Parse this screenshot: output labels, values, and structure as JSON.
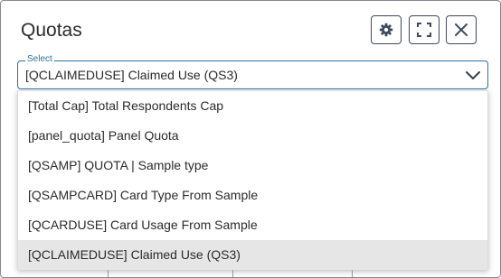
{
  "header": {
    "title": "Quotas",
    "buttons": [
      {
        "name": "settings",
        "icon": "gear-icon"
      },
      {
        "name": "expand",
        "icon": "expand-icon"
      },
      {
        "name": "close",
        "icon": "close-icon"
      }
    ]
  },
  "select": {
    "label": "Select",
    "value": "[QCLAIMEDUSE] Claimed Use (QS3)",
    "icon": "chevron-down-icon"
  },
  "dropdown": {
    "options": [
      {
        "label": "[Total Cap] Total Respondents Cap"
      },
      {
        "label": "[panel_quota] Panel Quota"
      },
      {
        "label": "[QSAMP] QUOTA | Sample type"
      },
      {
        "label": "[QSAMPCARD] Card Type From Sample"
      },
      {
        "label": "[QCARDUSE] Card Usage From Sample"
      },
      {
        "label": "[QCLAIMEDUSE] Claimed Use (QS3)"
      }
    ],
    "selected_index": 5
  },
  "colors": {
    "accent": "#2f6fa8",
    "button_border": "#3c4b5f",
    "selected_bg": "#e6e6e6"
  }
}
